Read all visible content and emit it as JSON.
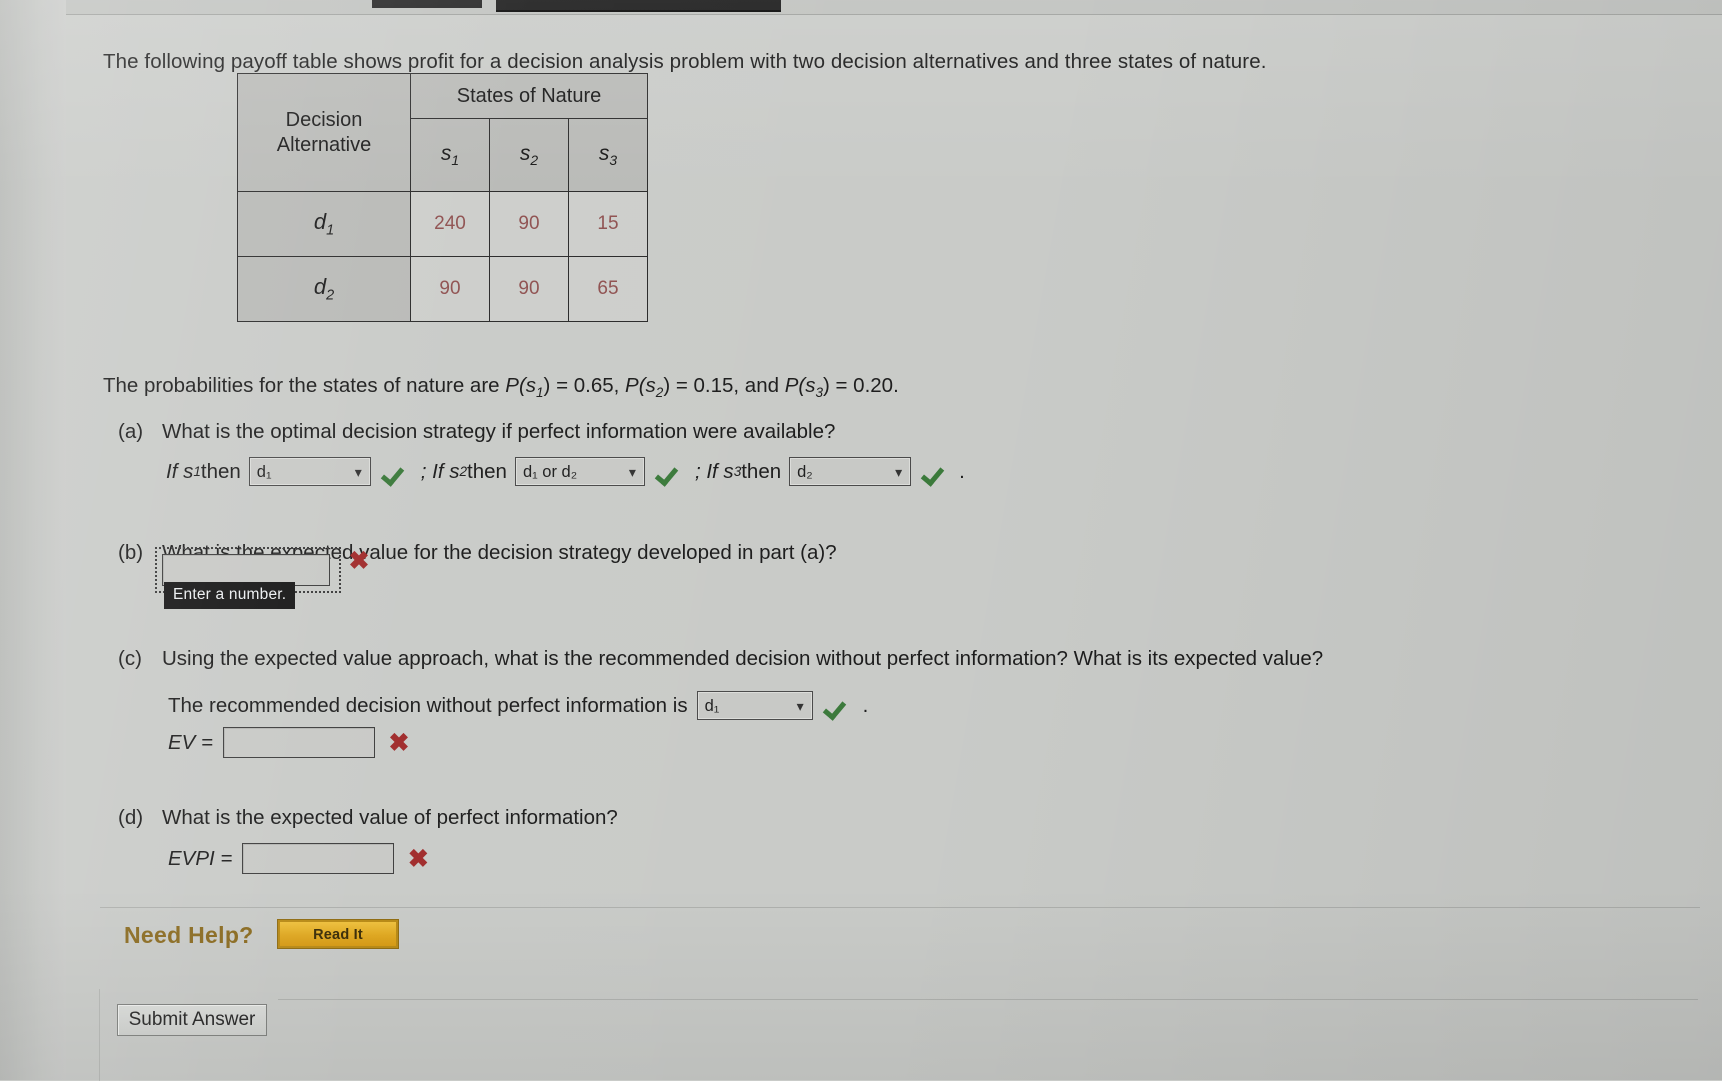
{
  "intro": {
    "text": "The following payoff table shows profit for a decision analysis problem with two decision alternatives and three states of nature."
  },
  "payoff_table": {
    "corner_line1": "Decision",
    "corner_line2": "Alternative",
    "states_header": "States of Nature",
    "state_labels": [
      "s",
      "s",
      "s"
    ],
    "state_subs": [
      "1",
      "2",
      "3"
    ],
    "rows": [
      {
        "label": "d",
        "sub": "1",
        "values": [
          "240",
          "90",
          "15"
        ]
      },
      {
        "label": "d",
        "sub": "2",
        "values": [
          "90",
          "90",
          "65"
        ]
      }
    ]
  },
  "probabilities": {
    "prefix": "The probabilities for the states of nature are ",
    "p1_name": "P(s",
    "p1_sub": "1",
    "p1_value": ") = 0.65, ",
    "p2_name": "P(s",
    "p2_sub": "2",
    "p2_value": ") = 0.15, and ",
    "p3_name": "P(s",
    "p3_sub": "3",
    "p3_value": ") = 0.20."
  },
  "part_a": {
    "label": "(a)",
    "question": "What is the optimal decision strategy if perfect information were available?",
    "if1_prefix": "If s",
    "if1_sub": "1",
    "if1_then": " then",
    "dd1_value": "d₁",
    "sep1": "; If s",
    "if2_sub": "2",
    "if2_then": " then",
    "dd2_value": "d₁ or d₂",
    "sep2": "; If s",
    "if3_sub": "3",
    "if3_then": " then",
    "dd3_value": "d₂",
    "period": "."
  },
  "part_b": {
    "label": "(b)",
    "question": "What is the expected value for the decision strategy developed in part (a)?",
    "input_value": "",
    "tooltip": "Enter a number.",
    "status": "incorrect"
  },
  "part_c": {
    "label": "(c)",
    "question": "Using the expected value approach, what is the recommended decision without perfect information? What is its expected value?",
    "recommend_text": "The recommended decision without perfect information is",
    "dd_value": "d₁",
    "period": ".",
    "ev_label": "EV =",
    "ev_value": "",
    "ev_status": "incorrect"
  },
  "part_d": {
    "label": "(d)",
    "question": "What is the expected value of perfect information?",
    "evpi_label": "EVPI =",
    "evpi_value": "",
    "evpi_status": "incorrect"
  },
  "footer": {
    "need_help_label": "Need Help?",
    "read_it_label": "Read It",
    "submit_label": "Submit Answer"
  },
  "icons": {
    "check": "✓",
    "cross": "✖",
    "caret": "∨"
  }
}
